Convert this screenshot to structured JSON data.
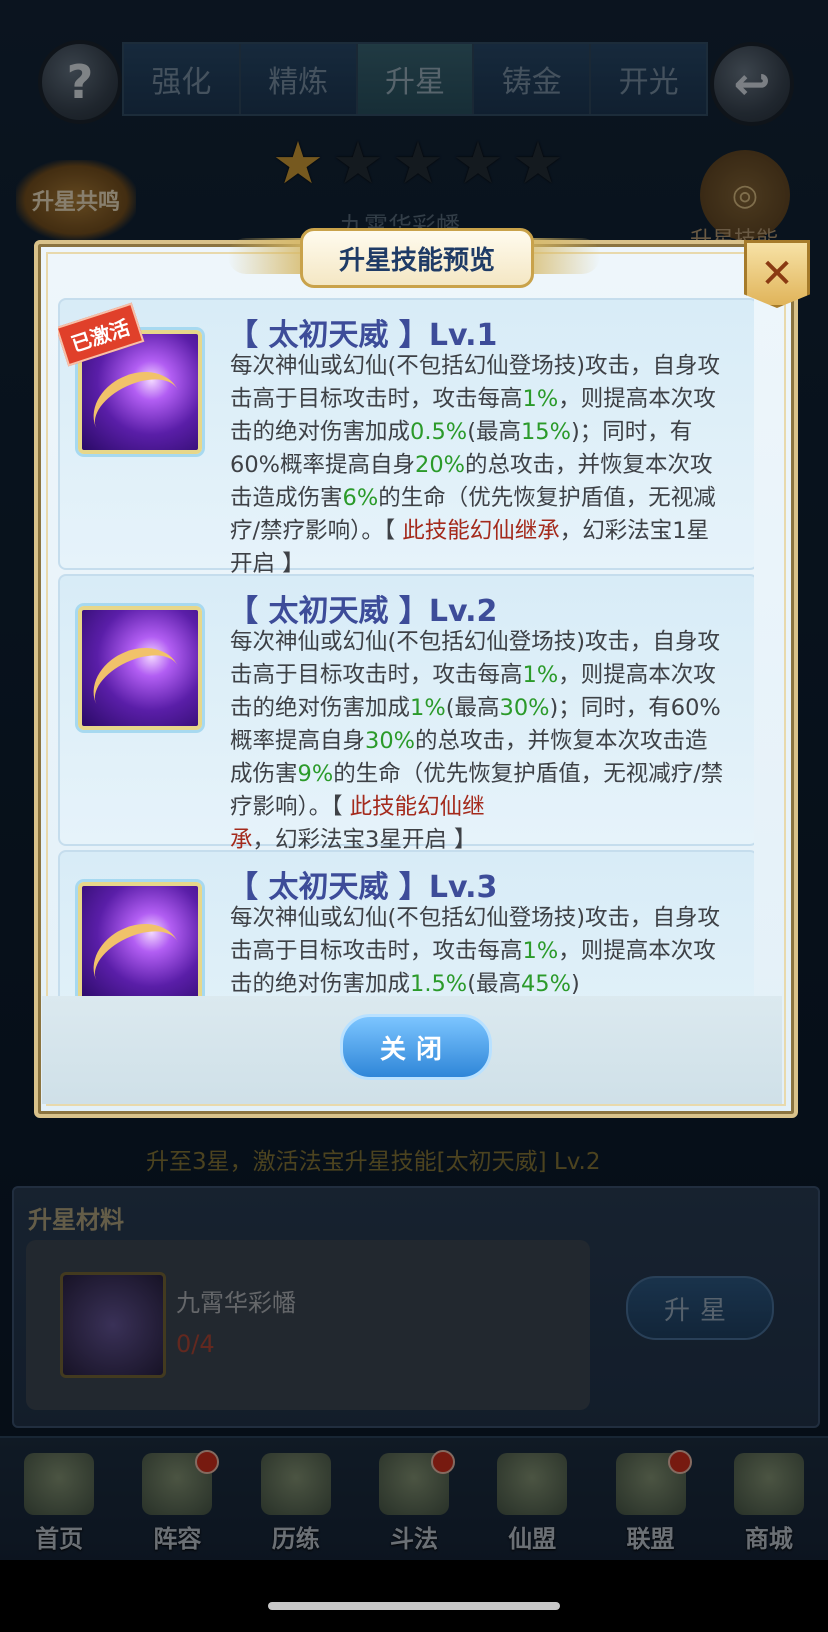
{
  "top": {
    "tabs": [
      {
        "label": "强化",
        "active": false
      },
      {
        "label": "精炼",
        "active": false
      },
      {
        "label": "升星",
        "active": true
      },
      {
        "label": "铸金",
        "active": false
      },
      {
        "label": "开光",
        "active": false
      }
    ],
    "help_symbol": "?",
    "back_symbol": "↩",
    "stars_total": 5,
    "stars_filled": 1,
    "resonance_label": "升星共鸣",
    "item_name": "九霄华彩幡",
    "skill_label": "升星技能"
  },
  "modal": {
    "title": "升星技能预览",
    "close_symbol": "✕",
    "activated_badge": "已激活",
    "skills": [
      {
        "title": "【 太初天威 】Lv.1",
        "activated": true,
        "parts": [
          {
            "t": "每次神仙或幻仙(不包括幻仙登场技)攻击，自身攻击高于目标攻击时，攻击每高"
          },
          {
            "t": "1%",
            "c": "g"
          },
          {
            "t": "，则提高本次攻击的绝对伤害加成"
          },
          {
            "t": "0.5%",
            "c": "g"
          },
          {
            "t": "(最高"
          },
          {
            "t": "15%",
            "c": "g"
          },
          {
            "t": ")；同时，有60%概率提高自身"
          },
          {
            "t": "20%",
            "c": "g"
          },
          {
            "t": "的总攻击，并恢复本次攻击造成伤害"
          },
          {
            "t": "6%",
            "c": "g"
          },
          {
            "t": "的生命（优先恢复护盾值，无视减疗/禁疗影响）。【 "
          },
          {
            "t": "此技能幻仙继承",
            "c": "r"
          },
          {
            "t": "，幻彩法宝1星开启 】"
          }
        ]
      },
      {
        "title": "【 太初天威 】Lv.2",
        "activated": false,
        "parts": [
          {
            "t": "每次神仙或幻仙(不包括幻仙登场技)攻击，自身攻击高于目标攻击时，攻击每高"
          },
          {
            "t": "1%",
            "c": "g"
          },
          {
            "t": "，则提高本次攻击的绝对伤害加成"
          },
          {
            "t": "1%",
            "c": "g"
          },
          {
            "t": "(最高"
          },
          {
            "t": "30%",
            "c": "g"
          },
          {
            "t": ")；同时，有60%概率提高自身"
          },
          {
            "t": "30%",
            "c": "g"
          },
          {
            "t": "的总攻击，并恢复本次攻击造成伤害"
          },
          {
            "t": "9%",
            "c": "g"
          },
          {
            "t": "的生命（优先恢复护盾值，无视减疗/禁疗影响）。【 "
          },
          {
            "t": "此技能幻仙继承",
            "c": "r"
          },
          {
            "t": "，幻彩法宝3星开启 】"
          }
        ]
      },
      {
        "title": "【 太初天威 】Lv.3",
        "activated": false,
        "parts": [
          {
            "t": "每次神仙或幻仙(不包括幻仙登场技)攻击，自身攻击高于目标攻击时，攻击每高"
          },
          {
            "t": "1%",
            "c": "g"
          },
          {
            "t": "，则提高本次攻击的绝对伤害加成"
          },
          {
            "t": "1.5%",
            "c": "g"
          },
          {
            "t": "(最高"
          },
          {
            "t": "45%",
            "c": "g"
          },
          {
            "t": ")"
          }
        ]
      }
    ],
    "close_button": "关闭"
  },
  "hint": "升至3星，激活法宝升星技能[太初天威] Lv.2",
  "materials": {
    "title": "升星材料",
    "item_name": "九霄华彩幡",
    "count": "0/4",
    "upgrade_button": "升星"
  },
  "nav": [
    {
      "label": "首页",
      "dot": false
    },
    {
      "label": "阵容",
      "dot": true
    },
    {
      "label": "历练",
      "dot": false
    },
    {
      "label": "斗法",
      "dot": true
    },
    {
      "label": "仙盟",
      "dot": false
    },
    {
      "label": "联盟",
      "dot": true
    },
    {
      "label": "商城",
      "dot": false
    }
  ]
}
